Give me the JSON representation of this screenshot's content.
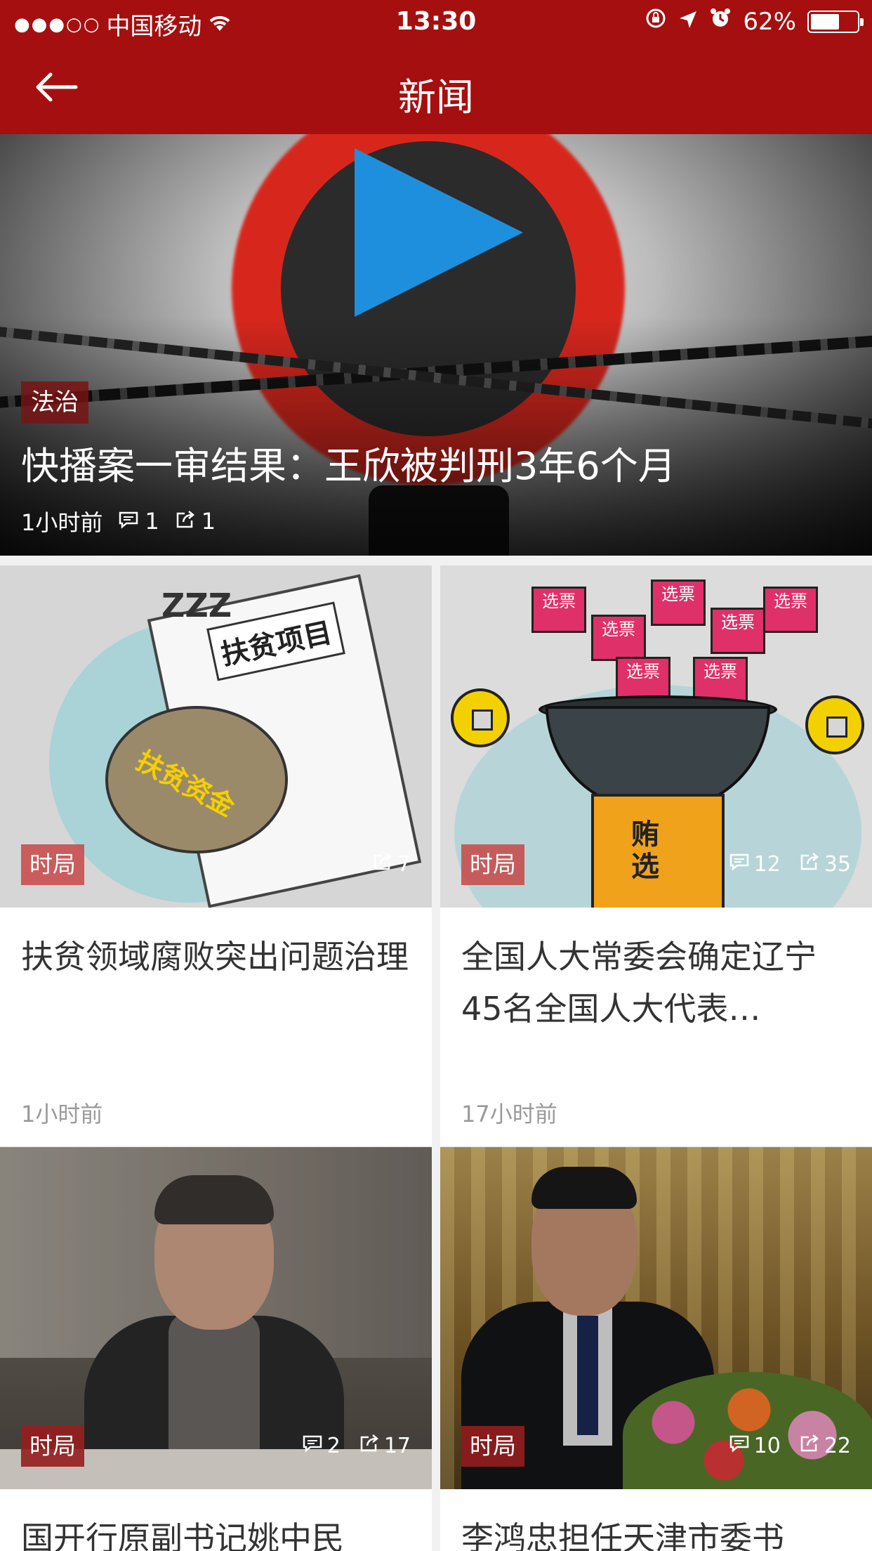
{
  "status_bar": {
    "signal": "●●●○○",
    "carrier": "中国移动",
    "time": "13:30",
    "battery": "62%",
    "battery_level": 0.62
  },
  "nav": {
    "title": "新闻",
    "back_icon": "arrow-left-icon"
  },
  "hero": {
    "tag": "法治",
    "title": "快播案一审结果：王欣被判刑3年6个月",
    "time": "1小时前",
    "comments": "1",
    "shares": "1"
  },
  "cards": [
    {
      "tag": "时局",
      "title": "扶贫领域腐败突出问题治理",
      "time": "1小时前",
      "comments": "",
      "shares": "7",
      "illustration_text": {
        "paper": "扶贫项目",
        "bag": "扶贫资金",
        "zz": "ZZZ"
      }
    },
    {
      "tag": "时局",
      "title": "全国人大常委会确定辽宁45名全国人大代表…",
      "time": "17小时前",
      "comments": "12",
      "shares": "35",
      "illustration_text": {
        "vote": "选票",
        "yen": "贿选"
      }
    },
    {
      "tag": "时局",
      "title": "国开行原副书记姚中民",
      "comments": "2",
      "shares": "17"
    },
    {
      "tag": "时局",
      "title": "李鸿忠担任天津市委书",
      "comments": "10",
      "shares": "22"
    }
  ],
  "colors": {
    "brand_red": "#a60f0f",
    "tag_red": "#c0392b",
    "text_dark": "#333333",
    "text_muted": "#9a9a9a"
  }
}
